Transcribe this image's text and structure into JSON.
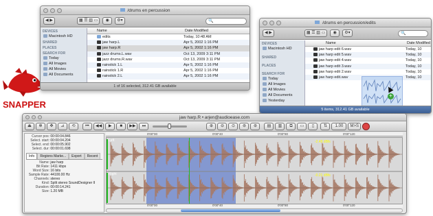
{
  "logo": {
    "text": "SNAPPER"
  },
  "finder_left": {
    "path": "/drums en percussion",
    "sidebar": [
      {
        "header": "DEVICES",
        "items": [
          "Macintosh HD"
        ]
      },
      {
        "header": "SHARED",
        "items": []
      },
      {
        "header": "PLACES",
        "items": []
      },
      {
        "header": "SEARCH FOR",
        "items": [
          "Today",
          "All Images",
          "All Movies",
          "All Documents"
        ]
      }
    ],
    "columns": [
      "Name",
      "Date Modified"
    ],
    "rows": [
      {
        "name": "edits",
        "date": "Today, 10:48 AM",
        "kind": "folder"
      },
      {
        "name": "jaw harp.L",
        "date": "Apr 5, 2002 1:16 PM",
        "kind": "file"
      },
      {
        "name": "jaw harp.R",
        "date": "Apr 5, 2002 1:16 PM",
        "kind": "file"
      },
      {
        "name": "jazz drums.L.wav",
        "date": "Oct 13, 2009 3:11 PM",
        "kind": "file"
      },
      {
        "name": "jazz drums.R.wav",
        "date": "Oct 13, 2009 3:11 PM",
        "kind": "file"
      },
      {
        "name": "rainstick 1.L",
        "date": "Apr 5, 2002 1:16 PM",
        "kind": "file"
      },
      {
        "name": "rainstick 1.R",
        "date": "Apr 5, 2002 1:16 PM",
        "kind": "file"
      },
      {
        "name": "rainstick 2.L",
        "date": "Apr 5, 2002 1:16 PM",
        "kind": "file"
      }
    ],
    "status": "1 of 16 selected, 312.41 GB available"
  },
  "finder_right": {
    "path": "/drums en percussion/edits",
    "sidebar": [
      {
        "header": "DEVICES",
        "items": [
          "Macintosh HD"
        ]
      },
      {
        "header": "SHARED",
        "items": []
      },
      {
        "header": "PLACES",
        "items": []
      },
      {
        "header": "SEARCH FOR",
        "items": [
          "Today",
          "All Images",
          "All Movies",
          "All Documents",
          "Yesterday"
        ]
      }
    ],
    "columns": [
      "Name",
      "Date Modified"
    ],
    "rows": [
      {
        "name": "jaw harp edit 6.wav",
        "date": "Today, 10"
      },
      {
        "name": "jaw harp edit 5.wav",
        "date": "Today, 10"
      },
      {
        "name": "jaw harp edit 4.wav",
        "date": "Today, 10"
      },
      {
        "name": "jaw harp edit 3.wav",
        "date": "Today, 10"
      },
      {
        "name": "jaw harp edit 2.wav",
        "date": "Today, 10"
      },
      {
        "name": "jaw harp edit.wav",
        "date": "Today, 10"
      }
    ],
    "status": "5 items, 312.41 GB available"
  },
  "snapper": {
    "title": "jaw harp.R • arjen@audioease.com",
    "zoom_value": "1.00",
    "ms_label": "M>S",
    "info_fields": [
      {
        "label": "Cursor pos:",
        "value": "00:00:04.846"
      },
      {
        "label": "Select. start:",
        "value": "00:00:04.204"
      },
      {
        "label": "Select. end:",
        "value": "00:00:05.902"
      },
      {
        "label": "Select. dur:",
        "value": "00:00:01.698"
      }
    ],
    "tabs": [
      "Info",
      "Regions Marke...",
      "Export",
      "Recent"
    ],
    "meta": [
      {
        "label": "Name:",
        "value": "jaw harp"
      },
      {
        "label": "Bit Rate:",
        "value": "1411 kbps"
      },
      {
        "label": "Word Size:",
        "value": "16 bits"
      },
      {
        "label": "Sample Rate:",
        "value": "44100.00 Hz"
      },
      {
        "label": "Channels:",
        "value": "stereo"
      },
      {
        "label": "Kind:",
        "value": "Split stereo SoundDesigner II"
      },
      {
        "label": "Duration:",
        "value": "00:00:14.241"
      },
      {
        "label": "Size:",
        "value": "1.20 MB"
      }
    ],
    "timeline_top": [
      "0'00\"00",
      "0'00\"40",
      "0'00\"80",
      "0'00\"120"
    ],
    "timeline_bottom": [
      "0'00\"00",
      "0'00\"40",
      "0'00\"80",
      "0'00\"120"
    ],
    "channel_left": "Left",
    "channel_right": "Right",
    "peak_left": "-2.49 dBfs",
    "peak_right": "-0.21 dBfs",
    "colors": {
      "waveform": "#a87a66",
      "selection": "#3e63c9",
      "wave_bg": "#d9d9d9",
      "playhead": "#22bb22"
    }
  }
}
